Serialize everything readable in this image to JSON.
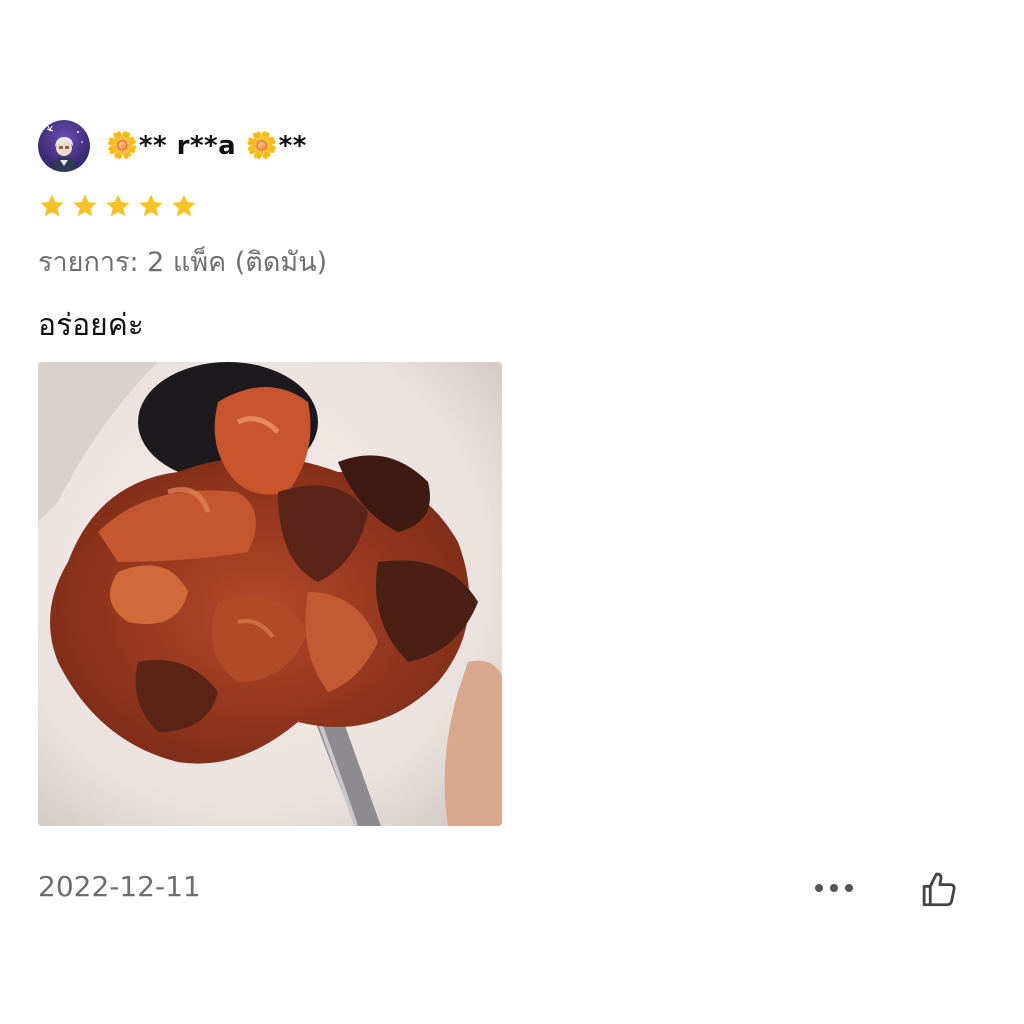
{
  "review": {
    "username": "🌼** r**a 🌼**",
    "avatar_icon": "user-avatar-icon",
    "rating": 5,
    "rating_max": 5,
    "star_color": "#F6C325",
    "variation": "รายการ: 2 แพ็ค (ติดมัน)",
    "comment": "อร่อยค่ะ",
    "photo_icon": "food-photo",
    "date": "2022-12-11",
    "more_icon": "more-options-icon",
    "like_icon": "thumbs-up-icon"
  }
}
